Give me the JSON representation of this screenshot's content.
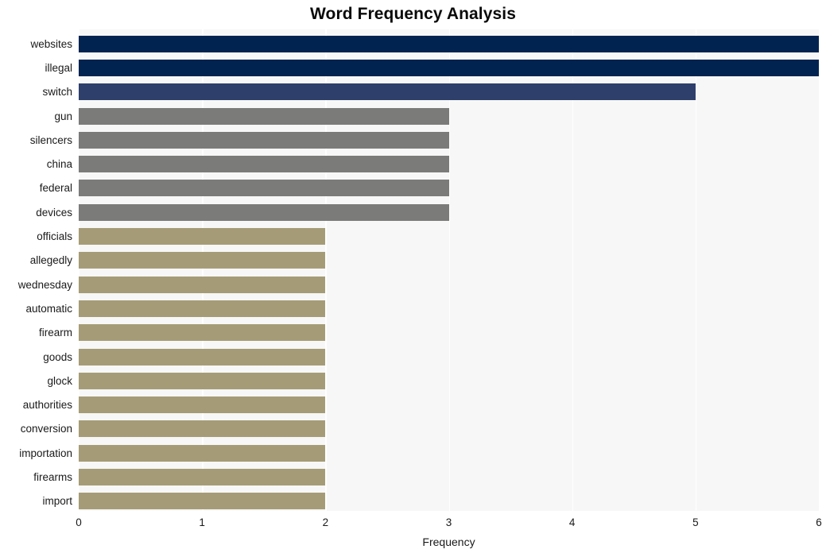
{
  "chart_data": {
    "type": "bar",
    "orientation": "horizontal",
    "title": "Word Frequency Analysis",
    "xlabel": "Frequency",
    "ylabel": "",
    "xlim": [
      0,
      6
    ],
    "xticks": [
      0,
      1,
      2,
      3,
      4,
      5,
      6
    ],
    "xtick_labels": [
      "0",
      "1",
      "2",
      "3",
      "4",
      "5",
      "6"
    ],
    "grid": true,
    "grid_axis": "x",
    "legend": "none",
    "categories": [
      "websites",
      "illegal",
      "switch",
      "gun",
      "silencers",
      "china",
      "federal",
      "devices",
      "officials",
      "allegedly",
      "wednesday",
      "automatic",
      "firearm",
      "goods",
      "glock",
      "authorities",
      "conversion",
      "importation",
      "firearms",
      "import"
    ],
    "values": [
      6,
      6,
      5,
      3,
      3,
      3,
      3,
      3,
      2,
      2,
      2,
      2,
      2,
      2,
      2,
      2,
      2,
      2,
      2,
      2
    ],
    "bar_colors": [
      "#012350",
      "#012350",
      "#2e3f6b",
      "#7b7b79",
      "#7b7b79",
      "#7b7b79",
      "#7b7b79",
      "#7b7b79",
      "#a59c77",
      "#a59c77",
      "#a59c77",
      "#a59c77",
      "#a59c77",
      "#a59c77",
      "#a59c77",
      "#a59c77",
      "#a59c77",
      "#a59c77",
      "#a59c77",
      "#a59c77"
    ]
  },
  "style": {
    "figure_background": "#ffffff",
    "plot_background": "#f7f7f7",
    "gridline_color": "#ffffff",
    "title_color": "#0a0a0a",
    "tick_label_color": "#1a1a1a"
  }
}
